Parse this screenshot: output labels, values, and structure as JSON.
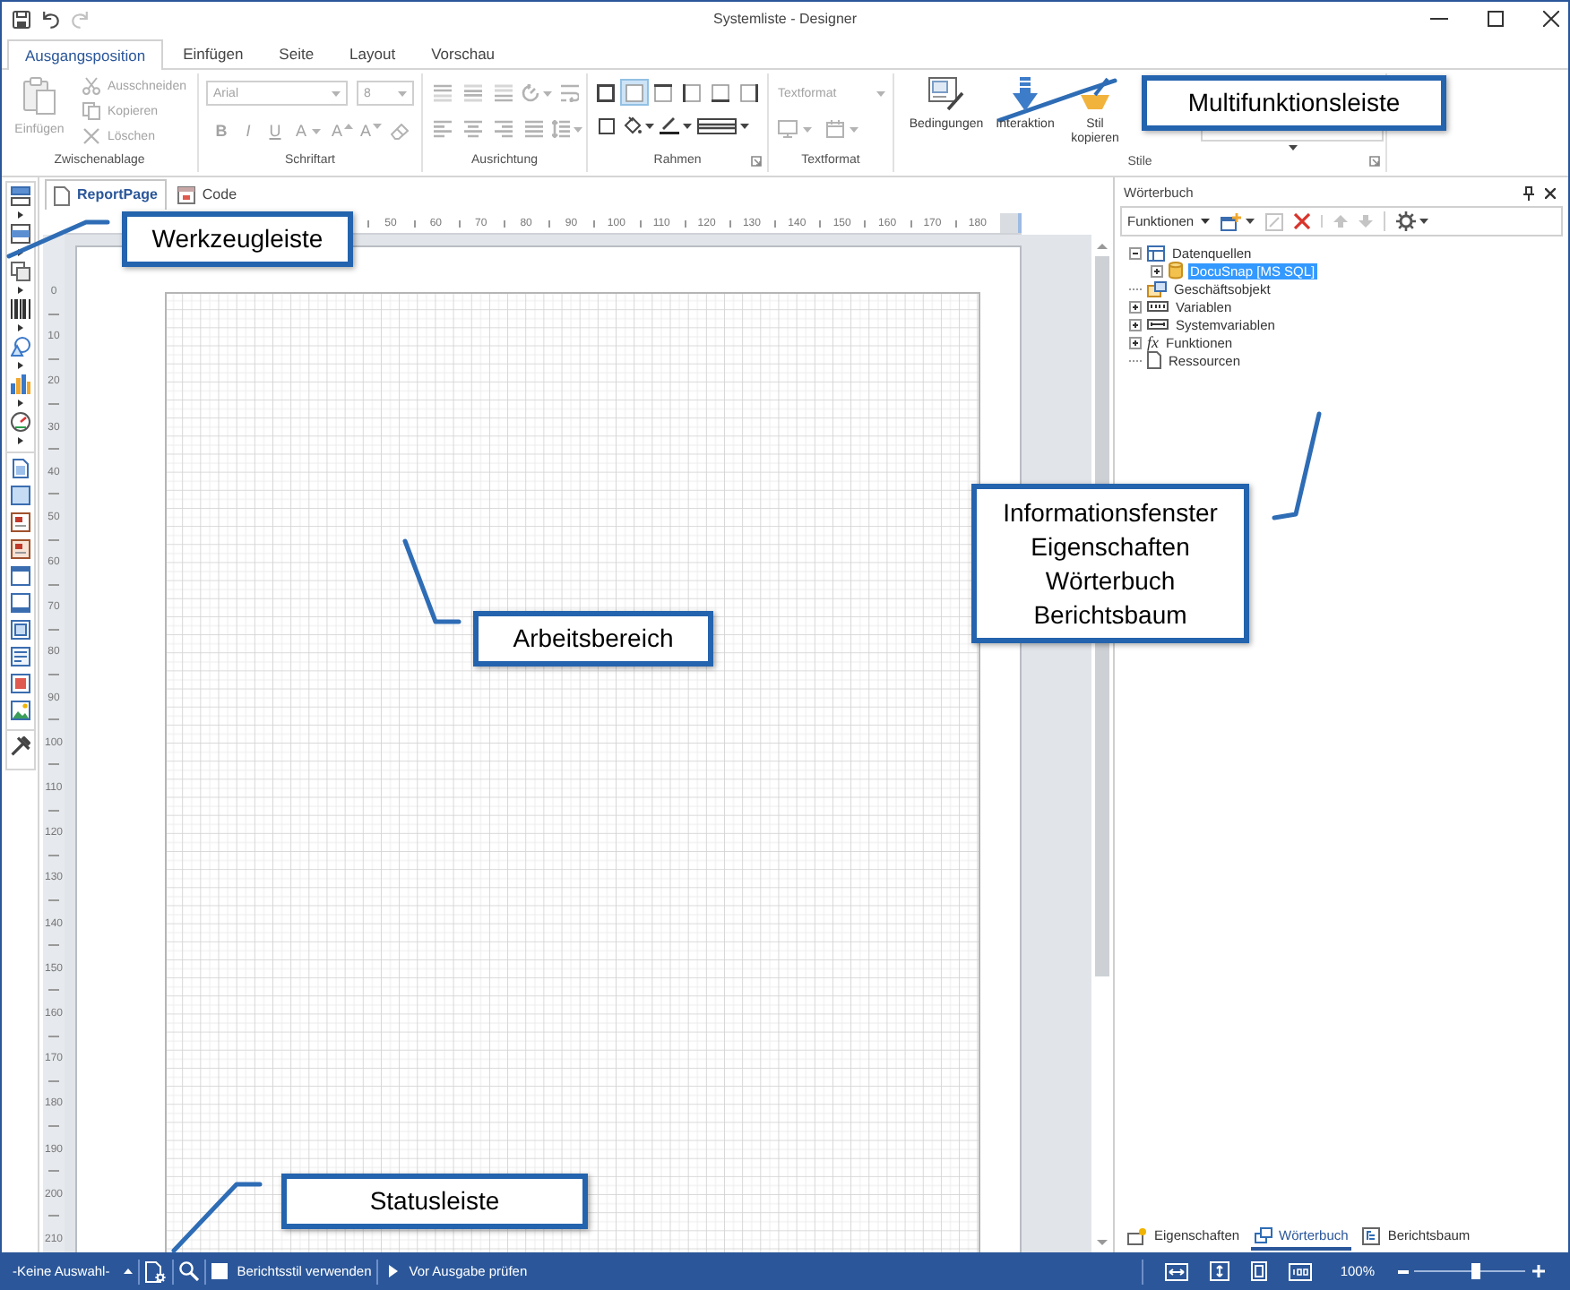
{
  "window": {
    "title": "Systemliste - Designer",
    "quick_access": [
      {
        "kind": "save",
        "disabled": false
      },
      {
        "kind": "undo",
        "disabled": false
      },
      {
        "kind": "redo",
        "disabled": true
      }
    ]
  },
  "ribbon_tabs": [
    {
      "label": "Ausgangsposition",
      "selected": true
    },
    {
      "label": "Einfügen",
      "selected": false
    },
    {
      "label": "Seite",
      "selected": false
    },
    {
      "label": "Layout",
      "selected": false
    },
    {
      "label": "Vorschau",
      "selected": false
    }
  ],
  "ribbon": {
    "clipboard": {
      "label": "Zwischenablage",
      "disabled": true,
      "paste": "Einfügen",
      "actions": [
        {
          "kind": "cut",
          "label": "Ausschneiden"
        },
        {
          "kind": "copy",
          "label": "Kopieren"
        },
        {
          "kind": "delete",
          "label": "Löschen"
        }
      ]
    },
    "font": {
      "label": "Schriftart",
      "disabled": true,
      "family": "Arial",
      "size": "8",
      "styles": [
        {
          "kind": "bold",
          "glyph": "B"
        },
        {
          "kind": "italic",
          "glyph": "I"
        },
        {
          "kind": "underline",
          "glyph": "U"
        },
        {
          "kind": "color",
          "glyph": "A"
        },
        {
          "kind": "grow",
          "glyph": "A"
        },
        {
          "kind": "shrink",
          "glyph": "A"
        },
        {
          "kind": "eraser"
        }
      ]
    },
    "alignment": {
      "label": "Ausrichtung",
      "disabled": true,
      "rows": [
        [
          {
            "kind": "top"
          },
          {
            "kind": "middle"
          },
          {
            "kind": "bottom"
          },
          {
            "kind": "rotate"
          },
          {
            "kind": "wrap"
          }
        ],
        [
          {
            "kind": "left"
          },
          {
            "kind": "center"
          },
          {
            "kind": "right"
          },
          {
            "kind": "justify"
          },
          {
            "kind": "spacing"
          }
        ]
      ]
    },
    "borders": {
      "label": "Rahmen",
      "disabled": false,
      "sides": [
        {
          "kind": "all",
          "selected": false
        },
        {
          "kind": "none",
          "selected": true
        },
        {
          "kind": "top",
          "selected": false
        },
        {
          "kind": "left",
          "selected": false
        },
        {
          "kind": "bottom",
          "selected": false
        },
        {
          "kind": "right",
          "selected": false
        }
      ],
      "tools": [
        {
          "kind": "shadow"
        },
        {
          "kind": "fill"
        },
        {
          "kind": "pen"
        },
        {
          "kind": "line_style"
        }
      ]
    },
    "text_format": {
      "label": "Textformat",
      "disabled": true,
      "value": "Textformat",
      "tools": [
        {
          "kind": "display"
        },
        {
          "kind": "date"
        }
      ]
    },
    "styles": {
      "label": "Stile",
      "disabled": false,
      "buttons": [
        {
          "kind": "conditions",
          "label": "Bedingungen"
        },
        {
          "kind": "interaction",
          "label": "Interaktion"
        },
        {
          "kind": "copy_style",
          "label": "Stil kopieren"
        }
      ]
    }
  },
  "toolbox": [
    [
      {
        "kind": "bands",
        "submenu": true
      },
      {
        "kind": "cross_bands",
        "submenu": true
      },
      {
        "kind": "components",
        "submenu": true
      },
      {
        "kind": "barcode",
        "submenu": true
      },
      {
        "kind": "shapes",
        "submenu": true
      },
      {
        "kind": "chart",
        "submenu": true
      },
      {
        "kind": "gauge",
        "submenu": true
      }
    ],
    [
      {
        "kind": "page",
        "submenu": false
      },
      {
        "kind": "panel",
        "submenu": false
      },
      {
        "kind": "text",
        "submenu": false
      },
      {
        "kind": "rich_text",
        "submenu": false
      },
      {
        "kind": "window",
        "submenu": false
      },
      {
        "kind": "frame",
        "submenu": false
      },
      {
        "kind": "container",
        "submenu": false
      },
      {
        "kind": "text_image",
        "submenu": false
      },
      {
        "kind": "image_text",
        "submenu": false
      },
      {
        "kind": "image",
        "submenu": false
      }
    ],
    [
      {
        "kind": "tools",
        "submenu": false
      }
    ]
  ],
  "document_tabs": [
    {
      "kind": "page",
      "label": "ReportPage",
      "selected": true
    },
    {
      "kind": "code",
      "label": "Code",
      "selected": false
    }
  ],
  "rulers": {
    "horizontal": [
      "50",
      "60",
      "70",
      "80",
      "90",
      "100",
      "110",
      "120",
      "130",
      "140",
      "150",
      "160",
      "170",
      "180"
    ],
    "vertical": [
      "0",
      "10",
      "20",
      "30",
      "40",
      "50",
      "60",
      "70",
      "80",
      "90",
      "100",
      "110",
      "120",
      "130",
      "140",
      "150",
      "160",
      "170",
      "180",
      "190",
      "200",
      "210"
    ]
  },
  "dictionary_panel": {
    "title": "Wörterbuch",
    "toolbar": {
      "menu": "Funktionen",
      "tools": [
        [
          {
            "kind": "add",
            "dropdown": true,
            "disabled": false
          },
          {
            "kind": "edit",
            "dropdown": false,
            "disabled": true
          },
          {
            "kind": "delete",
            "dropdown": false,
            "disabled": false
          }
        ],
        [
          {
            "kind": "up",
            "dropdown": false,
            "disabled": true
          },
          {
            "kind": "down",
            "dropdown": false,
            "disabled": true
          }
        ],
        [
          {
            "kind": "settings",
            "dropdown": true,
            "disabled": false
          }
        ]
      ]
    },
    "tree": [
      {
        "kind": "datasources",
        "label": "Datenquellen",
        "expanded": true,
        "selected": false,
        "children": [
          {
            "kind": "database",
            "label": "DocuSnap [MS SQL]",
            "expanded": false,
            "selected": true
          }
        ]
      },
      {
        "kind": "business_object",
        "label": "Geschäftsobjekt",
        "selected": false
      },
      {
        "kind": "variables",
        "label": "Variablen",
        "expanded": false,
        "selected": false
      },
      {
        "kind": "system_variables",
        "label": "Systemvariablen",
        "expanded": false,
        "selected": false
      },
      {
        "kind": "functions",
        "glyph": "fx",
        "label": "Funktionen",
        "expanded": false,
        "selected": false
      },
      {
        "kind": "resources",
        "label": "Ressourcen",
        "selected": false
      }
    ],
    "tabs": [
      {
        "kind": "properties",
        "label": "Eigenschaften",
        "selected": false
      },
      {
        "kind": "dictionary",
        "label": "Wörterbuch",
        "selected": true
      },
      {
        "kind": "report_tree",
        "label": "Berichtsbaum",
        "selected": false
      }
    ]
  },
  "status_bar": {
    "selection": "-Keine Auswahl-",
    "report_style": {
      "label": "Berichtsstil verwenden",
      "checked": false
    },
    "check_output": "Vor Ausgabe prüfen",
    "view_tools": [
      {
        "kind": "fit_width"
      },
      {
        "kind": "fit_page"
      },
      {
        "kind": "single_page"
      },
      {
        "kind": "actual_size"
      }
    ],
    "zoom": {
      "reading": "100%",
      "level": 0.55
    }
  },
  "callouts": [
    {
      "lines": [
        "Multifunktionsleiste"
      ]
    },
    {
      "lines": [
        "Werkzeugleiste"
      ]
    },
    {
      "lines": [
        "Informationsfenster",
        "Eigenschaften",
        "Wörterbuch",
        "Berichtsbaum"
      ]
    },
    {
      "lines": [
        "Arbeitsbereich"
      ]
    },
    {
      "lines": [
        "Statusleiste"
      ]
    }
  ]
}
